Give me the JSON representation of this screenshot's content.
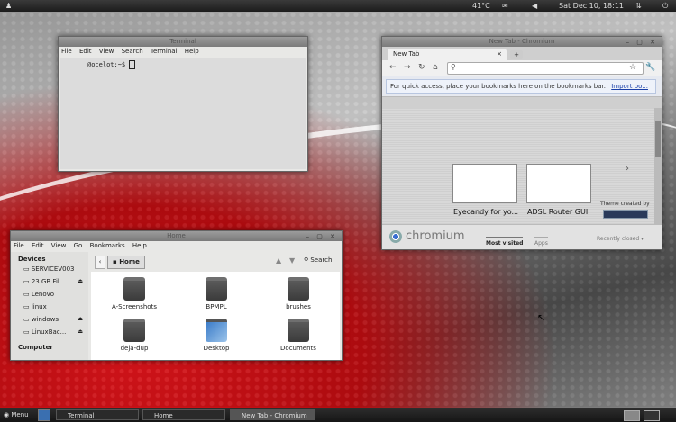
{
  "top_panel": {
    "temp": "41°C",
    "datetime": "Sat Dec 10, 18:11"
  },
  "terminal": {
    "title": "Terminal",
    "menu": [
      "File",
      "Edit",
      "View",
      "Search",
      "Terminal",
      "Help"
    ],
    "prompt": "@ocelot:~$"
  },
  "chromium": {
    "title": "New Tab - Chromium",
    "tab_label": "New Tab",
    "bookmark_note": "For quick access, place your bookmarks here on the bookmarks bar.",
    "bookmark_link": "Import bo...",
    "thumbs": [
      "Eyecandy for yo...",
      "ADSL Router GUI"
    ],
    "theme_created_by": "Theme created by",
    "brand": "chromium",
    "footer_tabs": [
      "Most visited",
      "Apps"
    ],
    "recently_closed": "Recently closed"
  },
  "files": {
    "title": "Home",
    "menu": [
      "File",
      "Edit",
      "View",
      "Go",
      "Bookmarks",
      "Help"
    ],
    "location": "Home",
    "search_label": "Search",
    "sidebar": {
      "devices_header": "Devices",
      "devices": [
        {
          "label": "SERVICEV003",
          "eject": false
        },
        {
          "label": "23 GB Fil...",
          "eject": true
        },
        {
          "label": "Lenovo",
          "eject": false
        },
        {
          "label": "linux",
          "eject": false
        },
        {
          "label": "windows",
          "eject": true
        },
        {
          "label": "LinuxBac...",
          "eject": true
        }
      ],
      "computer_header": "Computer"
    },
    "items": [
      "A-Screenshots",
      "BPMPL",
      "brushes",
      "deja-dup",
      "Desktop",
      "Documents"
    ]
  },
  "bottom_panel": {
    "menu": "Menu",
    "tasks": [
      "Terminal",
      "Home",
      "New Tab - Chromium"
    ]
  }
}
